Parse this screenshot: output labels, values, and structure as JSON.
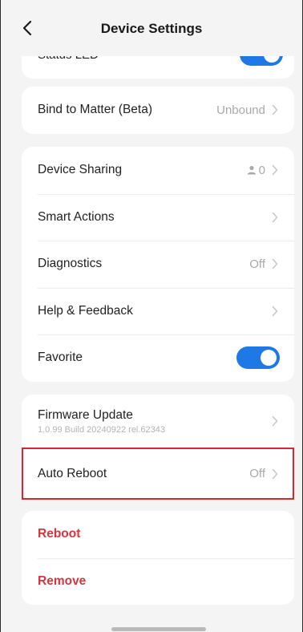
{
  "header": {
    "title": "Device Settings"
  },
  "peek": {
    "label": "Status LED"
  },
  "matter": {
    "label": "Bind to Matter (Beta)",
    "value": "Unbound"
  },
  "group2": {
    "sharing": {
      "label": "Device Sharing",
      "count": "0"
    },
    "smart_actions": {
      "label": "Smart Actions"
    },
    "diagnostics": {
      "label": "Diagnostics",
      "value": "Off"
    },
    "help": {
      "label": "Help & Feedback"
    },
    "favorite": {
      "label": "Favorite",
      "enabled": true
    }
  },
  "group3": {
    "firmware": {
      "label": "Firmware Update",
      "version": "1.0.99 Build 20240922 rel.62343"
    },
    "auto_reboot": {
      "label": "Auto Reboot",
      "value": "Off"
    }
  },
  "group4": {
    "reboot": {
      "label": "Reboot"
    },
    "remove": {
      "label": "Remove"
    }
  },
  "colors": {
    "accent": "#1e78e6",
    "danger": "#d8343c",
    "highlight": "#d9282d"
  }
}
